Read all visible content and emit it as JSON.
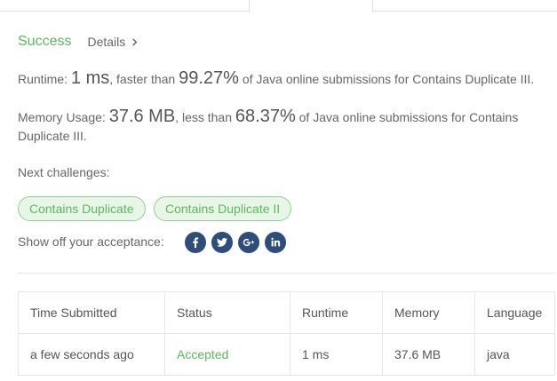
{
  "submission": {
    "status": "Success",
    "details_label": "Details"
  },
  "runtime": {
    "label": "Runtime:",
    "value": "1 ms",
    "faster_text": ", faster than",
    "percent": "99.27%",
    "suffix": "of Java online submissions for Contains Duplicate III."
  },
  "memory": {
    "label": "Memory Usage:",
    "value": "37.6 MB",
    "less_text": ", less than",
    "percent": "68.37%",
    "suffix": "of Java online submissions for Contains Duplicate III."
  },
  "next": {
    "label": "Next challenges:",
    "items": [
      "Contains Duplicate",
      "Contains Duplicate II"
    ]
  },
  "share": {
    "label": "Show off your acceptance:",
    "icons": [
      "facebook-icon",
      "twitter-icon",
      "google-plus-icon",
      "linkedin-icon"
    ],
    "icon_bg": "#2f4d7a"
  },
  "table": {
    "headers": [
      "Time Submitted",
      "Status",
      "Runtime",
      "Memory",
      "Language"
    ],
    "rows": [
      [
        "a few seconds ago",
        "Accepted",
        "1 ms",
        "37.6 MB",
        "java"
      ]
    ]
  },
  "colors": {
    "success": "#5cb85c",
    "chip_bg": "#e7f6e7",
    "chip_border": "#8fd08f"
  }
}
